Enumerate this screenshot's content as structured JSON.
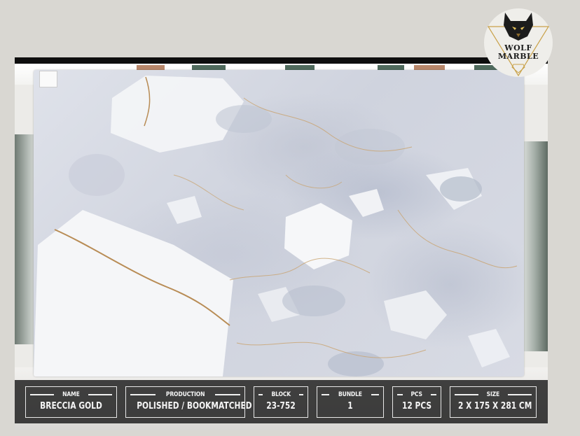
{
  "brand": {
    "line1": "WOLF",
    "line2": "MARBLE"
  },
  "specs": [
    {
      "label": "NAME",
      "value": "BRECCIA GOLD"
    },
    {
      "label": "PRODUCTION",
      "value": "POLISHED / BOOKMATCHED"
    },
    {
      "label": "BLOCK",
      "value": "23-752"
    },
    {
      "label": "BUNDLE",
      "value": "1"
    },
    {
      "label": "PCS",
      "value": "12 PCS"
    },
    {
      "label": "SIZE",
      "value": "2 X 175 X 281 CM"
    }
  ],
  "colors": {
    "vein": "#c29a63",
    "bar": "#1e1e1e",
    "text": "#f4f4f4",
    "logo_gold": "#c9a24a"
  }
}
